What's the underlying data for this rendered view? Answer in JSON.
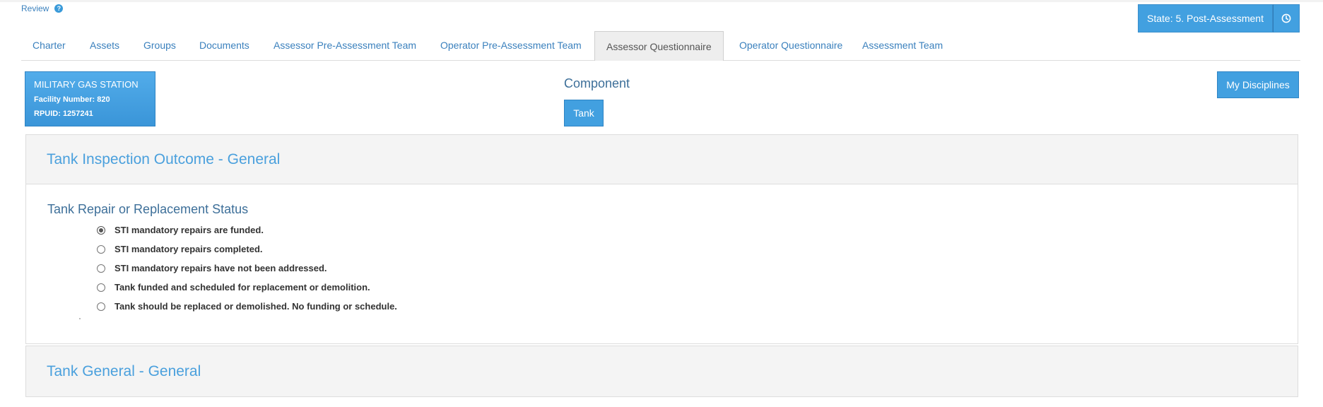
{
  "header": {
    "review_label": "Review",
    "help_icon": "question-circle-icon",
    "state_label": "State: 5. Post-Assessment",
    "state_icon": "clock-icon"
  },
  "tabs": [
    {
      "label": "Charter",
      "active": false
    },
    {
      "label": "Assets",
      "active": false
    },
    {
      "label": "Groups",
      "active": false
    },
    {
      "label": "Documents",
      "active": false
    },
    {
      "label": "Assessor Pre-Assessment Team",
      "active": false
    },
    {
      "label": "Operator Pre-Assessment Team",
      "active": false
    },
    {
      "label": "Assessor Questionnaire",
      "active": true
    },
    {
      "label": "Operator Questionnaire",
      "active": false
    },
    {
      "label": "Assessment Team",
      "active": false
    }
  ],
  "facility": {
    "name": "MILITARY GAS STATION",
    "number_line": "Facility Number: 820",
    "rpuid_line": "RPUID: 1257241"
  },
  "component": {
    "title": "Component",
    "button_label": "Tank"
  },
  "my_disciplines_label": "My Disciplines",
  "sections": [
    {
      "title": "Tank Inspection Outcome - General",
      "question": "Tank Repair or Replacement Status",
      "options": [
        {
          "label": "STI mandatory repairs are funded.",
          "checked": true
        },
        {
          "label": "STI mandatory repairs completed.",
          "checked": false
        },
        {
          "label": "STI mandatory repairs have not been addressed.",
          "checked": false
        },
        {
          "label": "Tank funded and scheduled for replacement or demolition.",
          "checked": false
        },
        {
          "label": "Tank should be replaced or demolished. No funding or schedule.",
          "checked": false
        }
      ]
    },
    {
      "title": "Tank General - General"
    }
  ],
  "colors": {
    "accent": "#42a0e0",
    "link": "#3a80bd",
    "heading": "#4aa0dd"
  }
}
